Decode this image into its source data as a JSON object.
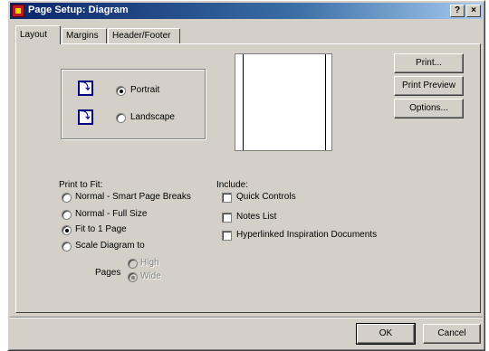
{
  "window": {
    "title": "Page Setup: Diagram",
    "help_label": "?",
    "close_label": "×"
  },
  "tabs": [
    {
      "label": "Layout"
    },
    {
      "label": "Margins"
    },
    {
      "label": "Header/Footer"
    }
  ],
  "orientation": {
    "portrait_label": "Portrait",
    "landscape_label": "Landscape",
    "selected": "Portrait"
  },
  "print_to_fit": {
    "heading": "Print to Fit:",
    "options": [
      {
        "label": "Normal - Smart Page Breaks"
      },
      {
        "label": "Normal - Full Size"
      },
      {
        "label": "Fit to 1 Page"
      },
      {
        "label": "Scale Diagram to"
      }
    ],
    "selected": "Fit to 1 Page",
    "pages_label": "Pages",
    "high_label": "High",
    "wide_label": "Wide"
  },
  "include": {
    "heading": "Include:",
    "items": [
      {
        "label": "Quick Controls"
      },
      {
        "label": "Notes List"
      },
      {
        "label": "Hyperlinked Inspiration Documents"
      }
    ]
  },
  "side_buttons": {
    "print": "Print...",
    "print_preview": "Print Preview",
    "options": "Options..."
  },
  "footer": {
    "ok": "OK",
    "cancel": "Cancel"
  }
}
